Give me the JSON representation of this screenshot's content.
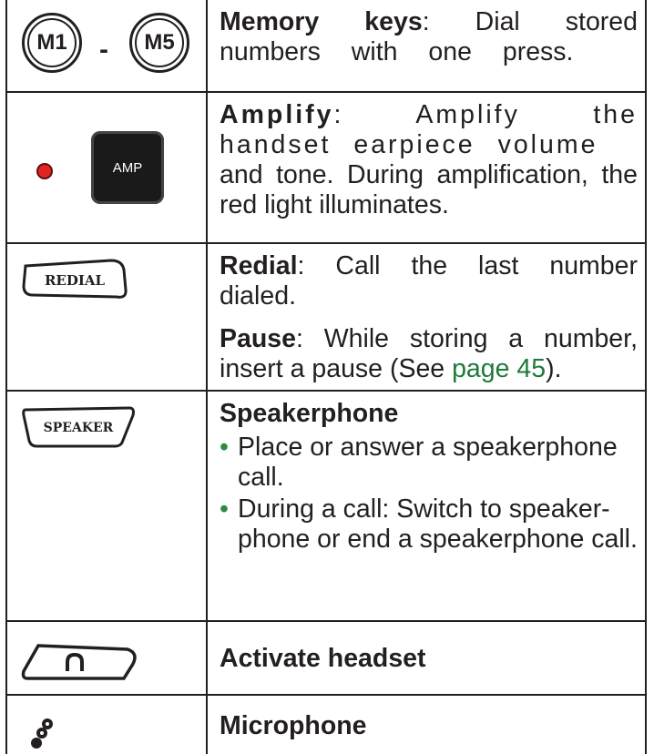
{
  "rows": [
    {
      "icon": {
        "m1": "M1",
        "dash": "-",
        "m5": "M5"
      },
      "label": "Memory keys",
      "text": ": Dial stored numbers with one press."
    },
    {
      "icon": {
        "amp": "AMP",
        "light_color": "#e32422"
      },
      "label": "Amplify",
      "text_a": ": Amplify the handset earpiece volume",
      "text_b": "and tone. During amplification, the red light illuminates."
    },
    {
      "icon": {
        "redial": "REDIAL"
      },
      "label": "Redial",
      "text": ": Call the last number dialed.",
      "label2": "Pause",
      "text2": ": While storing a number, insert a pause (See ",
      "link": "page 45",
      "text2_end": ")."
    },
    {
      "icon": {
        "speaker": "SPEAKER"
      },
      "label": "Speakerphone",
      "bullets": [
        "Place or answer a speakerphone call.",
        "During a call: Switch to speaker-phone or end a speakerphone call."
      ]
    },
    {
      "icon": {
        "name": "headset-icon"
      },
      "label": "Activate headset"
    },
    {
      "icon": {
        "name": "microphone-icon"
      },
      "label": "Microphone"
    }
  ],
  "colors": {
    "link": "#1f7a3a",
    "bullet": "#2f8a3f",
    "text": "#231f20"
  }
}
